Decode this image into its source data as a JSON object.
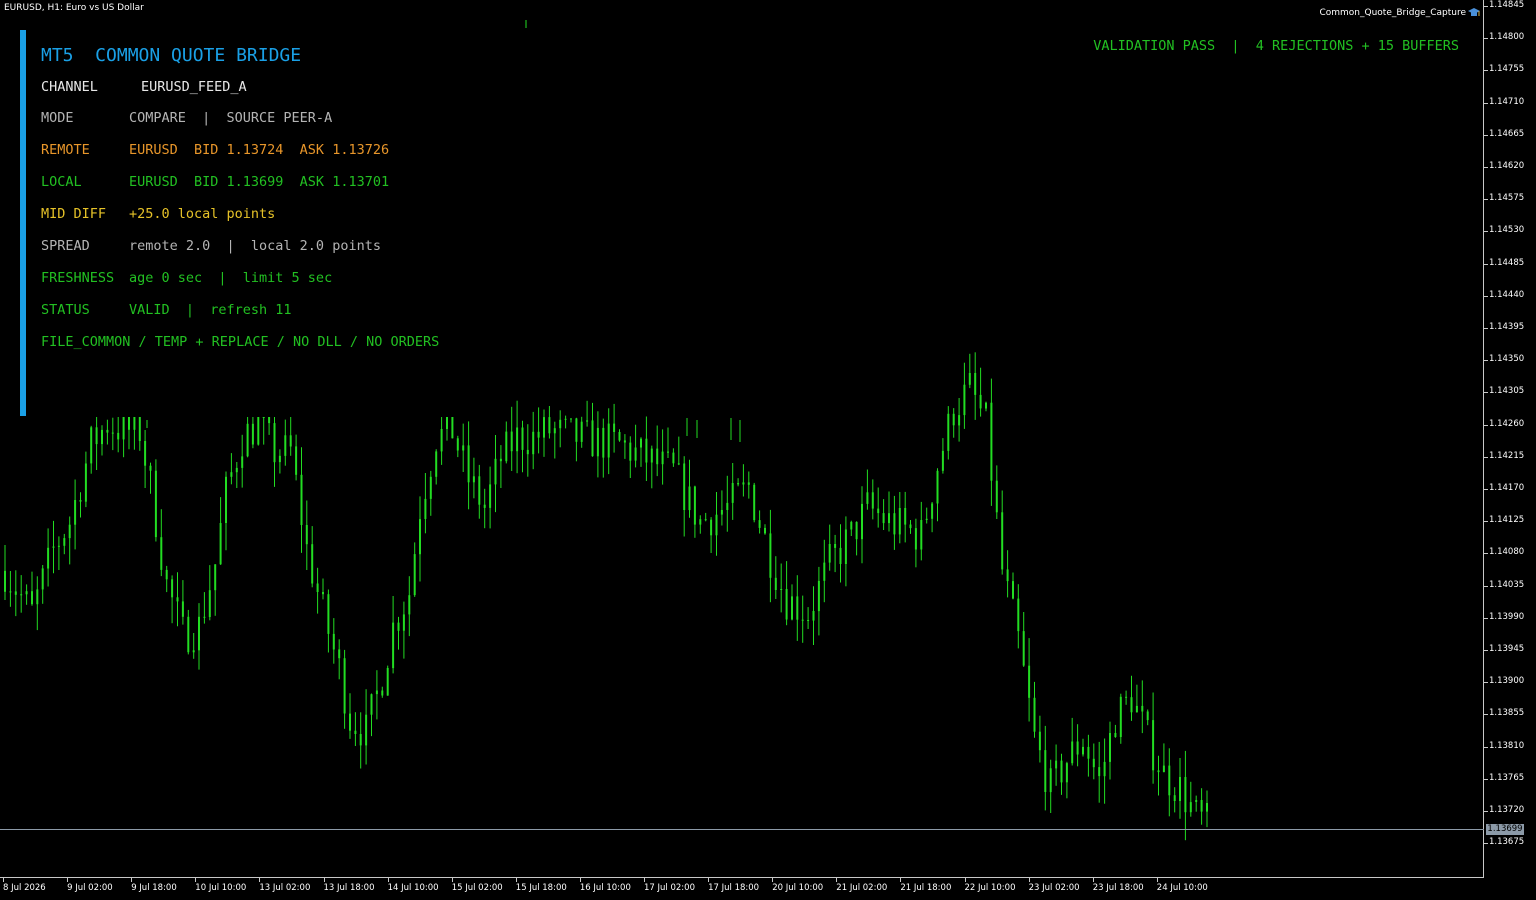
{
  "window": {
    "symbol_caption": "EURUSD, H1:  Euro vs US Dollar",
    "ea_name": "Common_Quote_Bridge_Capture",
    "ea_icon": "graduation-cap-icon"
  },
  "validation": "VALIDATION PASS  |  4 REJECTIONS + 15 BUFFERS",
  "panel": {
    "title": "MT5  COMMON QUOTE BRIDGE",
    "channel": {
      "key": "CHANNEL",
      "value": "EURUSD_FEED_A"
    },
    "mode": {
      "key": "MODE",
      "value": "COMPARE  |  SOURCE PEER-A"
    },
    "remote": {
      "key": "REMOTE",
      "value": "EURUSD  BID 1.13724  ASK 1.13726"
    },
    "local": {
      "key": "LOCAL",
      "value": "EURUSD  BID 1.13699  ASK 1.13701"
    },
    "mid_diff": {
      "key": "MID DIFF",
      "value": "+25.0 local points"
    },
    "spread": {
      "key": "SPREAD",
      "value": "remote 2.0  |  local 2.0 points"
    },
    "freshness": {
      "key": "FRESHNESS",
      "value": "age 0 sec  |  limit 5 sec"
    },
    "status": {
      "key": "STATUS",
      "value": "VALID  |  refresh 11"
    },
    "footer": "FILE_COMMON / TEMP + REPLACE / NO DLL / NO ORDERS"
  },
  "colors": {
    "accent": "#1aa0e6",
    "pass": "#22c022",
    "remote": "#e8962a",
    "diff": "#e6c228",
    "candle": "#22dd22",
    "background": "#000000"
  },
  "price_axis": {
    "ticks": [
      "1.14845",
      "1.14800",
      "1.14755",
      "1.14710",
      "1.14665",
      "1.14620",
      "1.14575",
      "1.14530",
      "1.14485",
      "1.14440",
      "1.14395",
      "1.14350",
      "1.14305",
      "1.14260",
      "1.14215",
      "1.14170",
      "1.14125",
      "1.14080",
      "1.14035",
      "1.13990",
      "1.13945",
      "1.13900",
      "1.13855",
      "1.13810",
      "1.13765",
      "1.13720",
      "1.13675"
    ],
    "current_price": "1.13699"
  },
  "time_axis": {
    "labels": [
      "8 Jul 2026",
      "9 Jul 02:00",
      "9 Jul 18:00",
      "10 Jul 10:00",
      "13 Jul 02:00",
      "13 Jul 18:00",
      "14 Jul 10:00",
      "15 Jul 02:00",
      "15 Jul 18:00",
      "16 Jul 10:00",
      "17 Jul 02:00",
      "17 Jul 18:00",
      "20 Jul 10:00",
      "21 Jul 02:00",
      "21 Jul 18:00",
      "22 Jul 10:00",
      "23 Jul 02:00",
      "23 Jul 18:00",
      "24 Jul 10:00"
    ]
  },
  "chart_data": {
    "type": "candlestick",
    "symbol": "EURUSD",
    "timeframe": "H1",
    "ylim": [
      1.13655,
      1.14855
    ],
    "current_price": 1.13699,
    "close_path": [
      [
        0,
        1.1405
      ],
      [
        5,
        1.1399
      ],
      [
        9,
        1.1408
      ],
      [
        12,
        1.1412
      ],
      [
        16,
        1.1423
      ],
      [
        19,
        1.1426
      ],
      [
        22,
        1.1425
      ],
      [
        25,
        1.1425
      ],
      [
        27,
        1.1417
      ],
      [
        30,
        1.1403
      ],
      [
        33,
        1.1396
      ],
      [
        36,
        1.1397
      ],
      [
        39,
        1.1406
      ],
      [
        41,
        1.1416
      ],
      [
        44,
        1.1424
      ],
      [
        47,
        1.1426
      ],
      [
        50,
        1.1422
      ],
      [
        53,
        1.1422
      ],
      [
        56,
        1.1408
      ],
      [
        59,
        1.1399
      ],
      [
        62,
        1.1391
      ],
      [
        64,
        1.1384
      ],
      [
        67,
        1.1382
      ],
      [
        70,
        1.139
      ],
      [
        72,
        1.1397
      ],
      [
        75,
        1.1402
      ],
      [
        77,
        1.1414
      ],
      [
        80,
        1.1424
      ],
      [
        83,
        1.1425
      ],
      [
        86,
        1.1418
      ],
      [
        89,
        1.1414
      ],
      [
        92,
        1.1421
      ],
      [
        95,
        1.1424
      ],
      [
        98,
        1.1424
      ],
      [
        101,
        1.1425
      ],
      [
        106,
        1.1424
      ],
      [
        114,
        1.1423
      ],
      [
        124,
        1.1419
      ],
      [
        129,
        1.1412
      ],
      [
        134,
        1.1414
      ],
      [
        138,
        1.1417
      ],
      [
        142,
        1.1407
      ],
      [
        145,
        1.1401
      ],
      [
        149,
        1.1399
      ],
      [
        153,
        1.1406
      ],
      [
        157,
        1.141
      ],
      [
        160,
        1.1414
      ],
      [
        164,
        1.1412
      ],
      [
        167,
        1.1411
      ],
      [
        170,
        1.141
      ],
      [
        173,
        1.142
      ],
      [
        176,
        1.1428
      ],
      [
        179,
        1.1431
      ],
      [
        182,
        1.1426
      ],
      [
        185,
        1.1405
      ],
      [
        188,
        1.1395
      ],
      [
        191,
        1.1381
      ],
      [
        194,
        1.1374
      ],
      [
        197,
        1.1378
      ],
      [
        200,
        1.1381
      ],
      [
        203,
        1.1375
      ],
      [
        206,
        1.1384
      ],
      [
        209,
        1.1387
      ],
      [
        212,
        1.1381
      ],
      [
        215,
        1.1376
      ],
      [
        218,
        1.1374
      ],
      [
        221,
        1.137
      ],
      [
        223,
        1.1369
      ]
    ]
  }
}
